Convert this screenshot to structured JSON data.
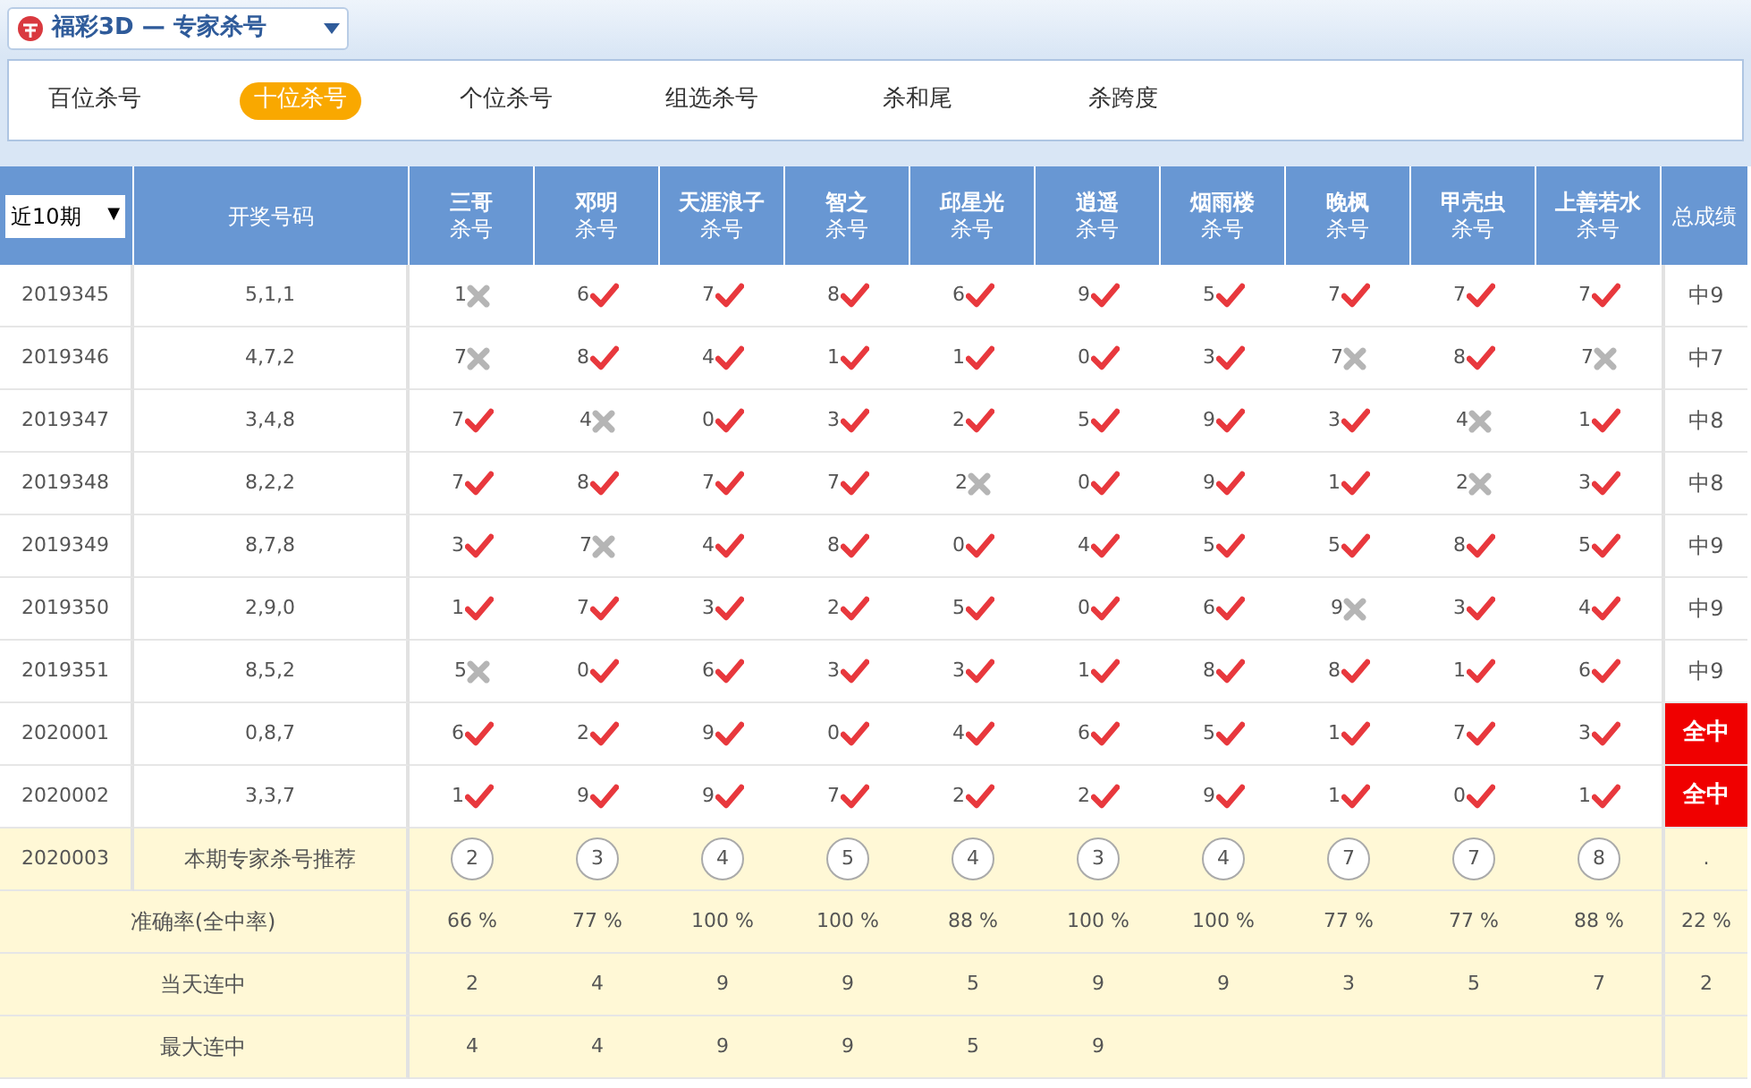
{
  "header": {
    "title": "福彩3D — 专家杀号"
  },
  "tabs": [
    {
      "label": "百位杀号",
      "selected": false
    },
    {
      "label": "十位杀号",
      "selected": true
    },
    {
      "label": "个位杀号",
      "selected": false
    },
    {
      "label": "组选杀号",
      "selected": false
    },
    {
      "label": "杀和尾",
      "selected": false
    },
    {
      "label": "杀跨度",
      "selected": false
    }
  ],
  "table": {
    "filter": {
      "value": "近10期",
      "arrow": "▼"
    },
    "numbers_heading": "开奖号码",
    "total_heading": "总成绩",
    "experts": [
      {
        "name": "三哥",
        "sub": "杀号"
      },
      {
        "name": "邓明",
        "sub": "杀号"
      },
      {
        "name": "天涯浪子",
        "sub": "杀号"
      },
      {
        "name": "智之",
        "sub": "杀号"
      },
      {
        "name": "邱星光",
        "sub": "杀号"
      },
      {
        "name": "逍遥",
        "sub": "杀号"
      },
      {
        "name": "烟雨楼",
        "sub": "杀号"
      },
      {
        "name": "晚枫",
        "sub": "杀号"
      },
      {
        "name": "甲壳虫",
        "sub": "杀号"
      },
      {
        "name": "上善若水",
        "sub": "杀号"
      }
    ],
    "rows": [
      {
        "period": "2019345",
        "numbers": "5,1,1",
        "picks": [
          {
            "digit": "1",
            "hit": false
          },
          {
            "digit": "6",
            "hit": true
          },
          {
            "digit": "7",
            "hit": true
          },
          {
            "digit": "8",
            "hit": true
          },
          {
            "digit": "6",
            "hit": true
          },
          {
            "digit": "9",
            "hit": true
          },
          {
            "digit": "5",
            "hit": true
          },
          {
            "digit": "7",
            "hit": true
          },
          {
            "digit": "7",
            "hit": true
          },
          {
            "digit": "7",
            "hit": true
          }
        ],
        "total": "中9",
        "full": false
      },
      {
        "period": "2019346",
        "numbers": "4,7,2",
        "picks": [
          {
            "digit": "7",
            "hit": false
          },
          {
            "digit": "8",
            "hit": true
          },
          {
            "digit": "4",
            "hit": true
          },
          {
            "digit": "1",
            "hit": true
          },
          {
            "digit": "1",
            "hit": true
          },
          {
            "digit": "0",
            "hit": true
          },
          {
            "digit": "3",
            "hit": true
          },
          {
            "digit": "7",
            "hit": false
          },
          {
            "digit": "8",
            "hit": true
          },
          {
            "digit": "7",
            "hit": false
          }
        ],
        "total": "中7",
        "full": false
      },
      {
        "period": "2019347",
        "numbers": "3,4,8",
        "picks": [
          {
            "digit": "7",
            "hit": true
          },
          {
            "digit": "4",
            "hit": false
          },
          {
            "digit": "0",
            "hit": true
          },
          {
            "digit": "3",
            "hit": true
          },
          {
            "digit": "2",
            "hit": true
          },
          {
            "digit": "5",
            "hit": true
          },
          {
            "digit": "9",
            "hit": true
          },
          {
            "digit": "3",
            "hit": true
          },
          {
            "digit": "4",
            "hit": false
          },
          {
            "digit": "1",
            "hit": true
          }
        ],
        "total": "中8",
        "full": false
      },
      {
        "period": "2019348",
        "numbers": "8,2,2",
        "picks": [
          {
            "digit": "7",
            "hit": true
          },
          {
            "digit": "8",
            "hit": true
          },
          {
            "digit": "7",
            "hit": true
          },
          {
            "digit": "7",
            "hit": true
          },
          {
            "digit": "2",
            "hit": false
          },
          {
            "digit": "0",
            "hit": true
          },
          {
            "digit": "9",
            "hit": true
          },
          {
            "digit": "1",
            "hit": true
          },
          {
            "digit": "2",
            "hit": false
          },
          {
            "digit": "3",
            "hit": true
          }
        ],
        "total": "中8",
        "full": false
      },
      {
        "period": "2019349",
        "numbers": "8,7,8",
        "picks": [
          {
            "digit": "3",
            "hit": true
          },
          {
            "digit": "7",
            "hit": false
          },
          {
            "digit": "4",
            "hit": true
          },
          {
            "digit": "8",
            "hit": true
          },
          {
            "digit": "0",
            "hit": true
          },
          {
            "digit": "4",
            "hit": true
          },
          {
            "digit": "5",
            "hit": true
          },
          {
            "digit": "5",
            "hit": true
          },
          {
            "digit": "8",
            "hit": true
          },
          {
            "digit": "5",
            "hit": true
          }
        ],
        "total": "中9",
        "full": false
      },
      {
        "period": "2019350",
        "numbers": "2,9,0",
        "picks": [
          {
            "digit": "1",
            "hit": true
          },
          {
            "digit": "7",
            "hit": true
          },
          {
            "digit": "3",
            "hit": true
          },
          {
            "digit": "2",
            "hit": true
          },
          {
            "digit": "5",
            "hit": true
          },
          {
            "digit": "0",
            "hit": true
          },
          {
            "digit": "6",
            "hit": true
          },
          {
            "digit": "9",
            "hit": false
          },
          {
            "digit": "3",
            "hit": true
          },
          {
            "digit": "4",
            "hit": true
          }
        ],
        "total": "中9",
        "full": false
      },
      {
        "period": "2019351",
        "numbers": "8,5,2",
        "picks": [
          {
            "digit": "5",
            "hit": false
          },
          {
            "digit": "0",
            "hit": true
          },
          {
            "digit": "6",
            "hit": true
          },
          {
            "digit": "3",
            "hit": true
          },
          {
            "digit": "3",
            "hit": true
          },
          {
            "digit": "1",
            "hit": true
          },
          {
            "digit": "8",
            "hit": true
          },
          {
            "digit": "8",
            "hit": true
          },
          {
            "digit": "1",
            "hit": true
          },
          {
            "digit": "6",
            "hit": true
          }
        ],
        "total": "中9",
        "full": false
      },
      {
        "period": "2020001",
        "numbers": "0,8,7",
        "picks": [
          {
            "digit": "6",
            "hit": true
          },
          {
            "digit": "2",
            "hit": true
          },
          {
            "digit": "9",
            "hit": true
          },
          {
            "digit": "0",
            "hit": true
          },
          {
            "digit": "4",
            "hit": true
          },
          {
            "digit": "6",
            "hit": true
          },
          {
            "digit": "5",
            "hit": true
          },
          {
            "digit": "1",
            "hit": true
          },
          {
            "digit": "7",
            "hit": true
          },
          {
            "digit": "3",
            "hit": true
          }
        ],
        "total": "全中",
        "full": true
      },
      {
        "period": "2020002",
        "numbers": "3,3,7",
        "picks": [
          {
            "digit": "1",
            "hit": true
          },
          {
            "digit": "9",
            "hit": true
          },
          {
            "digit": "9",
            "hit": true
          },
          {
            "digit": "7",
            "hit": true
          },
          {
            "digit": "2",
            "hit": true
          },
          {
            "digit": "2",
            "hit": true
          },
          {
            "digit": "9",
            "hit": true
          },
          {
            "digit": "1",
            "hit": true
          },
          {
            "digit": "0",
            "hit": true
          },
          {
            "digit": "1",
            "hit": true
          }
        ],
        "total": "全中",
        "full": true
      }
    ],
    "recommendation": {
      "period": "2020003",
      "label": "本期专家杀号推荐",
      "digits": [
        "2",
        "3",
        "4",
        "5",
        "4",
        "3",
        "4",
        "7",
        "7",
        "8"
      ],
      "total": "."
    },
    "accuracy": {
      "label": "准确率(全中率)",
      "values": [
        "66 %",
        "77 %",
        "100 %",
        "100 %",
        "88 %",
        "100 %",
        "100 %",
        "77 %",
        "77 %",
        "88 %"
      ],
      "total": "22 %"
    },
    "today_run": {
      "label": "当天连中",
      "values": [
        "2",
        "4",
        "9",
        "9",
        "5",
        "9",
        "9",
        "3",
        "5",
        "7"
      ],
      "total": "2"
    },
    "max_run": {
      "label": "最大连中",
      "values": [
        "4",
        "4",
        "9",
        "9",
        "5",
        "9"
      ]
    }
  }
}
